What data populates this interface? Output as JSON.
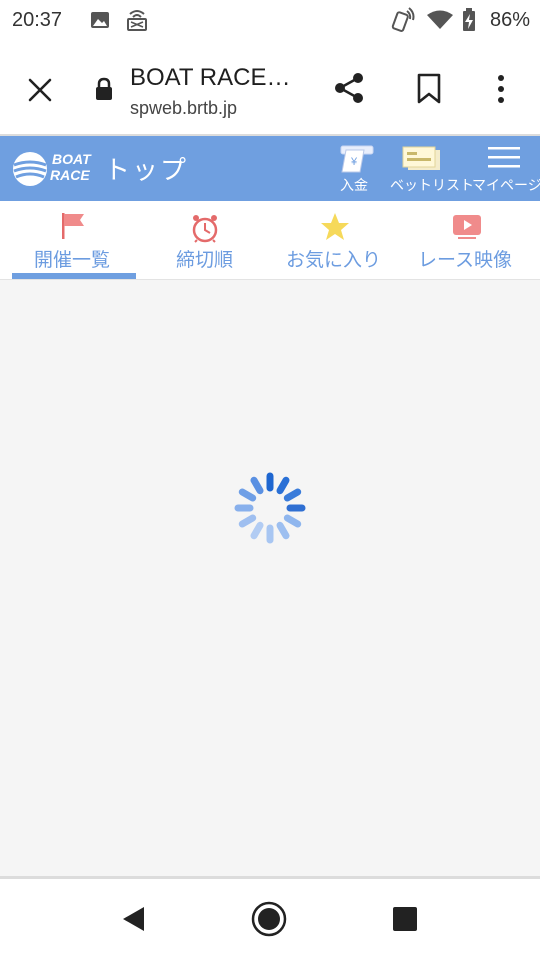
{
  "status": {
    "time": "20:37",
    "battery": "86%"
  },
  "browser": {
    "title": "BOAT RACE…",
    "url": "spweb.brtb.jp"
  },
  "header": {
    "logo_line1": "BOAT",
    "logo_line2": "RACE",
    "title": "トップ",
    "actions": [
      {
        "label": "入金",
        "icon": "deposit-icon"
      },
      {
        "label": "ベットリスト",
        "icon": "bet-list-icon"
      },
      {
        "label": "マイページ",
        "icon": "menu-icon"
      }
    ]
  },
  "tabs": [
    {
      "label": "開催一覧",
      "icon": "flag-icon",
      "active": true
    },
    {
      "label": "締切順",
      "icon": "alarm-clock-icon",
      "active": false
    },
    {
      "label": "お気に入り",
      "icon": "star-icon",
      "active": false
    },
    {
      "label": "レース映像",
      "icon": "video-play-icon",
      "active": false
    }
  ],
  "colors": {
    "header_bg": "#6f9fe0",
    "tab_text": "#6c9ce0",
    "spinner": "#4a86dc"
  }
}
